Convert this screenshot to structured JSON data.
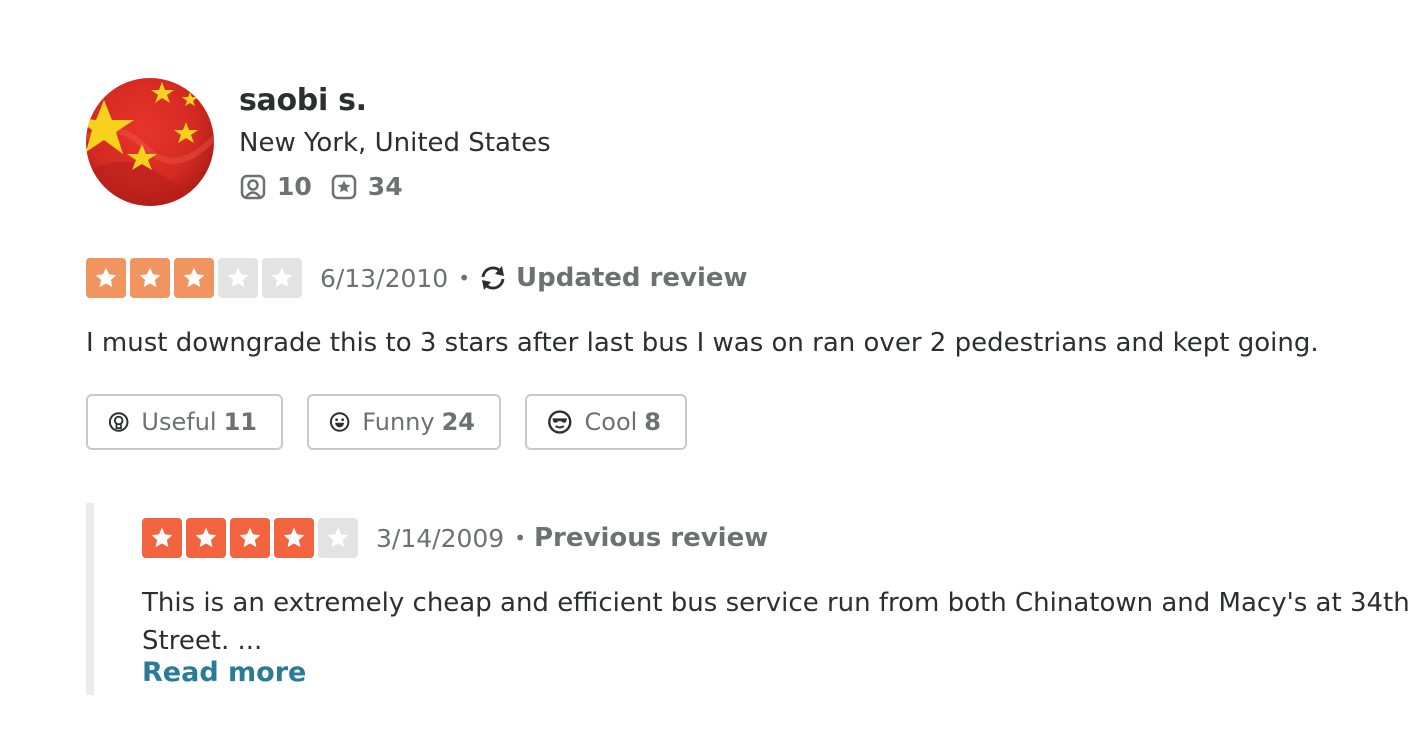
{
  "user": {
    "name": "saobi s.",
    "location": "New York, United States",
    "friends_count": "10",
    "reviews_count": "34",
    "friends_icon": "friends-icon",
    "reviews_icon": "review-star-icon"
  },
  "current_review": {
    "rating": 3,
    "max_rating": 5,
    "date": "6/13/2010",
    "separator": "•",
    "label": "Updated review",
    "label_icon": "refresh-icon",
    "text": "I must downgrade this to 3 stars after last bus I was on ran over 2 pedestrians and kept going.",
    "star_color": "#f0955f"
  },
  "reactions": [
    {
      "label": "Useful",
      "count": "11",
      "icon": "useful-icon"
    },
    {
      "label": "Funny",
      "count": "24",
      "icon": "funny-icon"
    },
    {
      "label": "Cool",
      "count": "8",
      "icon": "cool-icon"
    }
  ],
  "previous_review": {
    "rating": 4,
    "max_rating": 5,
    "date": "3/14/2009",
    "separator": "•",
    "label": "Previous review",
    "text_line1": "This is an extremely cheap and efficient bus service run from both Chinatown and Macy's at 34th",
    "text_line2": "Street. ...",
    "read_more": "Read more",
    "star_color": "#f26440"
  },
  "colors": {
    "empty_star": "#e3e3e3",
    "link": "#2b7a98",
    "muted_text": "#6e7072"
  }
}
